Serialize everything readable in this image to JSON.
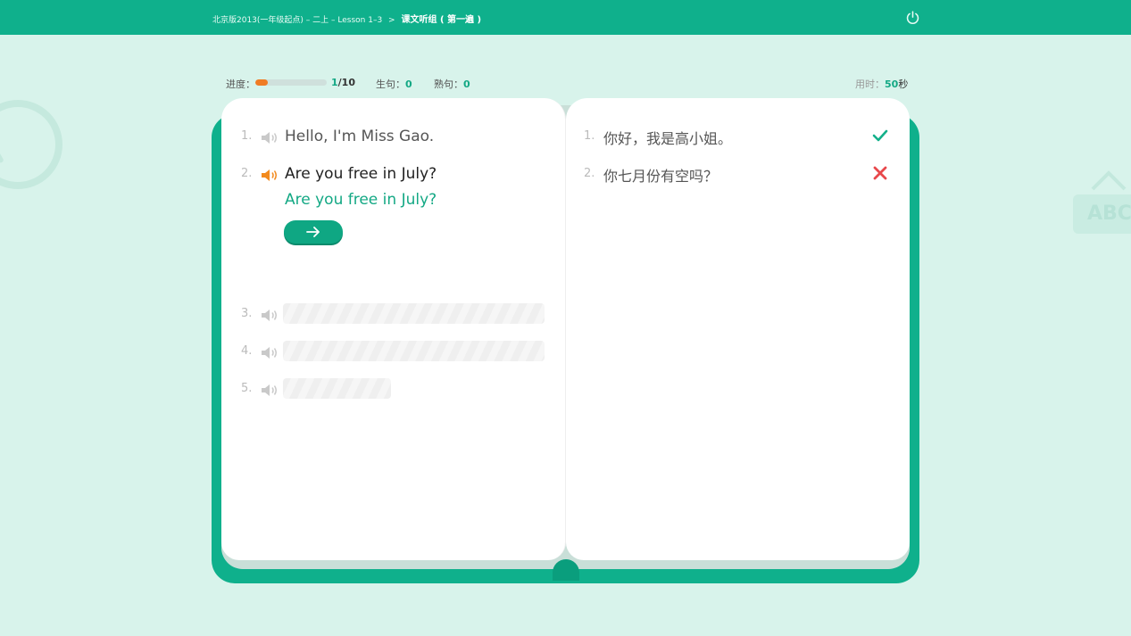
{
  "header": {
    "breadcrumb_path": "北京版2013(一年级起点) – 二上 – Lesson 1–3",
    "breadcrumb_sep": ">",
    "breadcrumb_current": "课文听组 ( 第一遍 )"
  },
  "stats": {
    "progress_label": "进度：",
    "progress_fraction": 0.1,
    "progress_current": "1",
    "progress_total": "/10",
    "new_label": "生句：",
    "new_count": "0",
    "familiar_label": "熟句：",
    "familiar_count": "0",
    "time_label": "用时：",
    "time_value": "50",
    "time_unit": "秒"
  },
  "left_page": {
    "lines": [
      {
        "index": "1.",
        "text": "Hello, I'm Miss Gao."
      },
      {
        "index": "2.",
        "text": "Are you free in July?"
      },
      {
        "index": "3."
      },
      {
        "index": "4."
      },
      {
        "index": "5."
      }
    ],
    "answer_text": "Are you free in July?"
  },
  "right_page": {
    "lines": [
      {
        "index": "1.",
        "text": "你好，我是高小姐。",
        "status": "correct"
      },
      {
        "index": "2.",
        "text": "你七月份有空吗？",
        "status": "wrong"
      }
    ]
  },
  "colors": {
    "brand": "#0fb08c",
    "correct": "#13b08a",
    "wrong": "#e8484b",
    "speaker_active": "#f28a1e",
    "progress_fill": "#f07c24"
  },
  "icons": {
    "power": "power-icon",
    "speaker": "speaker-icon",
    "next": "arrow-right-icon",
    "correct": "check-icon",
    "wrong": "cross-icon"
  },
  "decor": {
    "abc_text": "ABC"
  }
}
